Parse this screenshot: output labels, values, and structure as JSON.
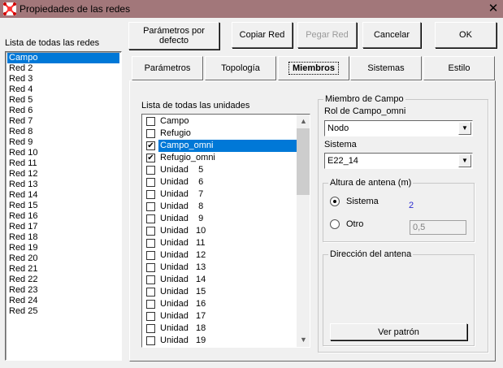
{
  "window": {
    "title": "Propiedades de las redes",
    "close_glyph": "✕"
  },
  "buttons": {
    "defaults": "Parámetros por defecto",
    "copy": "Copiar Red",
    "paste": "Pegar Red",
    "cancel": "Cancelar",
    "ok": "OK"
  },
  "networks": {
    "label": "Lista de todas las redes",
    "items": [
      "Campo",
      "Red  2",
      "Red  3",
      "Red  4",
      "Red  5",
      "Red  6",
      "Red  7",
      "Red  8",
      "Red  9",
      "Red 10",
      "Red 11",
      "Red 12",
      "Red 13",
      "Red 14",
      "Red 15",
      "Red 16",
      "Red 17",
      "Red 18",
      "Red 19",
      "Red 20",
      "Red 21",
      "Red 22",
      "Red 23",
      "Red 24",
      "Red 25"
    ],
    "selected": "Campo"
  },
  "tabs": [
    "Parámetros",
    "Topología",
    "Miembros",
    "Sistemas",
    "Estilo"
  ],
  "active_tab": "Miembros",
  "units": {
    "label": "Lista de todas las unidades",
    "items": [
      {
        "label": "Campo",
        "checked": false
      },
      {
        "label": "Refugio",
        "checked": false
      },
      {
        "label": "Campo_omni",
        "checked": true
      },
      {
        "label": "Refugio_omni",
        "checked": true
      },
      {
        "label": "Unidad    5",
        "checked": false
      },
      {
        "label": "Unidad    6",
        "checked": false
      },
      {
        "label": "Unidad    7",
        "checked": false
      },
      {
        "label": "Unidad    8",
        "checked": false
      },
      {
        "label": "Unidad    9",
        "checked": false
      },
      {
        "label": "Unidad   10",
        "checked": false
      },
      {
        "label": "Unidad   11",
        "checked": false
      },
      {
        "label": "Unidad   12",
        "checked": false
      },
      {
        "label": "Unidad   13",
        "checked": false
      },
      {
        "label": "Unidad   14",
        "checked": false
      },
      {
        "label": "Unidad   15",
        "checked": false
      },
      {
        "label": "Unidad   16",
        "checked": false
      },
      {
        "label": "Unidad   17",
        "checked": false
      },
      {
        "label": "Unidad   18",
        "checked": false
      },
      {
        "label": "Unidad   19",
        "checked": false
      }
    ],
    "selected": "Campo_omni",
    "check_glyph": "✔",
    "scroll_up_glyph": "▲",
    "scroll_down_glyph": "▼"
  },
  "member": {
    "group_title": "Miembro de Campo",
    "role_label": "Rol de Campo_omni",
    "role_value": "Nodo",
    "system_label": "Sistema",
    "system_value": "E22_14",
    "dropdown_glyph": "▼"
  },
  "antenna_height": {
    "group_title": "Altura de antena (m)",
    "system_option": "Sistema",
    "system_value": "2",
    "other_option": "Otro",
    "other_value": "0,5",
    "selected": "Sistema"
  },
  "antenna_direction": {
    "group_title": "Dirección del antena",
    "pattern_button": "Ver patrón"
  },
  "colors": {
    "selection": "#0078d7",
    "titlebar": "#a2777a",
    "value_blue": "#2b2bd0"
  }
}
